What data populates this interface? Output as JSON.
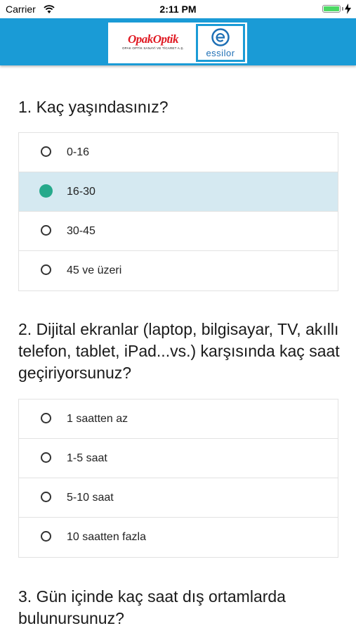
{
  "status_bar": {
    "carrier": "Carrier",
    "time": "2:11 PM"
  },
  "header": {
    "logo_left": {
      "name": "OpakOptik",
      "subtitle": "OPAK OPTİK SANAYİ VE TİCARET A.Ş."
    },
    "logo_right": {
      "name": "essilor"
    }
  },
  "questions": [
    {
      "text": "1. Kaç yaşındasınız?",
      "options": [
        "0-16",
        "16-30",
        "30-45",
        "45 ve üzeri"
      ],
      "selected": 1
    },
    {
      "text": "2. Dijital ekranlar (laptop, bilgisayar, TV, akıllı telefon, tablet, iPad...vs.) karşısında kaç saat geçiriyorsunuz?",
      "options": [
        "1 saatten az",
        "1-5 saat",
        "5-10 saat",
        "10 saatten fazla"
      ],
      "selected": null
    },
    {
      "text": "3. Gün içinde kaç saat dış ortamlarda bulunursunuz?"
    }
  ],
  "colors": {
    "header": "#1a9bd6",
    "selected_row": "#d5e9f1",
    "radio_on": "#26a98b",
    "battery": "#4cd964"
  }
}
